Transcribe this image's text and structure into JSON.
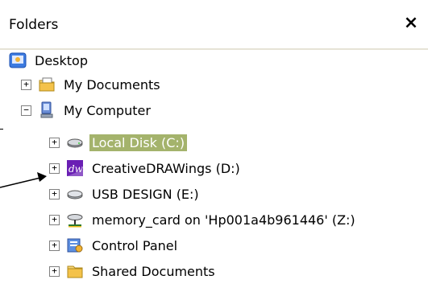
{
  "header": {
    "title": "Folders",
    "close": "×"
  },
  "tree": {
    "root": {
      "label": "Desktop"
    },
    "items": [
      {
        "label": "My Documents",
        "expander": "+"
      },
      {
        "label": "My Computer",
        "expander": "−"
      }
    ],
    "drives": [
      {
        "label": "Local Disk (C:)",
        "expander": "+",
        "selected": true
      },
      {
        "label": "CreativeDRAWings (D:)",
        "expander": "+"
      },
      {
        "label": "USB DESIGN (E:)",
        "expander": "+"
      },
      {
        "label": "memory_card on 'Hp001a4b961446' (Z:)",
        "expander": "+"
      },
      {
        "label": "Control Panel",
        "expander": "+"
      },
      {
        "label": "Shared Documents",
        "expander": "+"
      }
    ]
  },
  "colors": {
    "selection": "#a4b36c",
    "header_line": "#e6e3d6"
  }
}
